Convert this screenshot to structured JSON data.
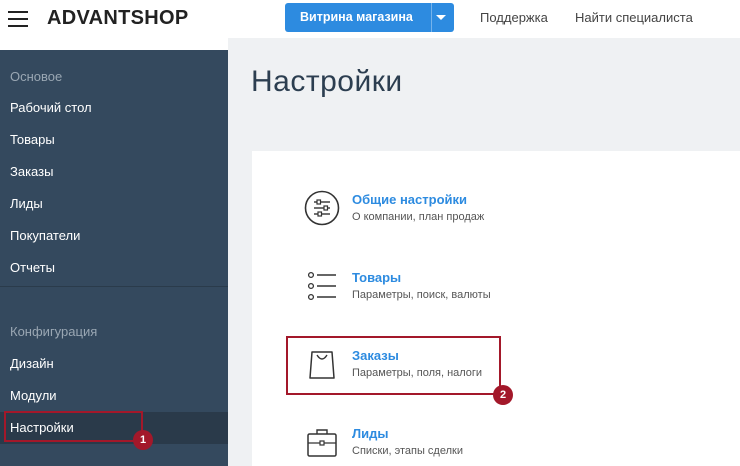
{
  "header": {
    "logo": "ADVANTSHOP",
    "store_button": "Витрина магазина",
    "links": [
      "Поддержка",
      "Найти специалиста"
    ]
  },
  "sidebar": {
    "section_main": "Основое",
    "main_items": [
      "Рабочий стол",
      "Товары",
      "Заказы",
      "Лиды",
      "Покупатели",
      "Отчеты"
    ],
    "section_config": "Конфигурация",
    "config_items": [
      "Дизайн",
      "Модули",
      "Настройки"
    ],
    "active_item": "Настройки"
  },
  "page": {
    "title": "Настройки",
    "settings": [
      {
        "title": "Общие настройки",
        "subtitle": "О компании, план продаж",
        "icon": "sliders-icon"
      },
      {
        "title": "Товары",
        "subtitle": "Параметры, поиск, валюты",
        "icon": "list-icon"
      },
      {
        "title": "Заказы",
        "subtitle": "Параметры, поля, налоги",
        "icon": "shopping-bag-icon"
      },
      {
        "title": "Лиды",
        "subtitle": "Списки, этапы сделки",
        "icon": "briefcase-icon"
      }
    ]
  },
  "annotations": {
    "badge_1": "1",
    "badge_2": "2",
    "color": "#a3182a"
  },
  "colors": {
    "accent": "#2d8be0",
    "sidebar": "#34495e",
    "highlight": "#a3182a"
  }
}
